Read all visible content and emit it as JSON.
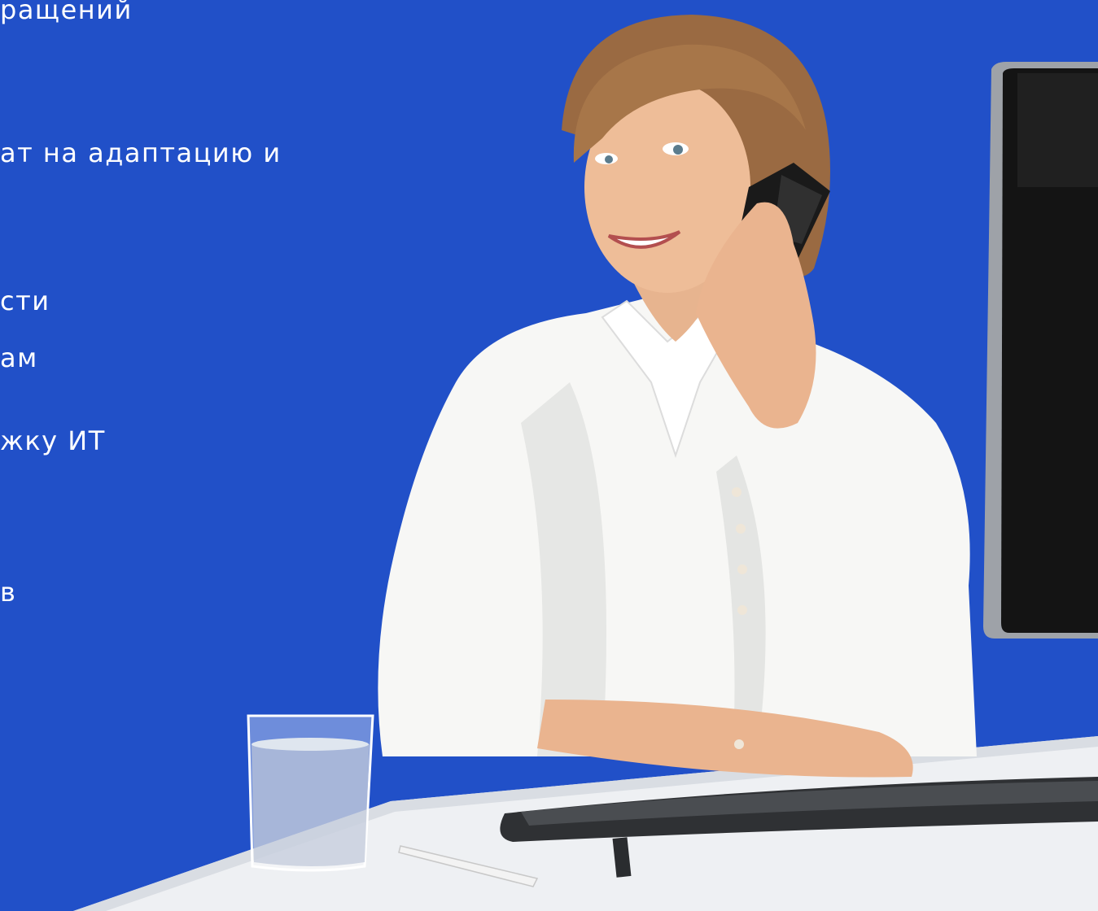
{
  "background_color": "#2150C8",
  "text_color": "#ffffff",
  "text_lines": [
    "ращений",
    "ат на адаптацию и",
    "сти",
    "ам",
    "жку ИТ",
    "в"
  ],
  "illustration": {
    "subject": "smiling woman in white blouse talking on a mobile phone at a desk",
    "objects": [
      "woman",
      "mobile-phone",
      "computer-monitor",
      "keyboard",
      "glass-of-water",
      "pen",
      "desk"
    ]
  }
}
